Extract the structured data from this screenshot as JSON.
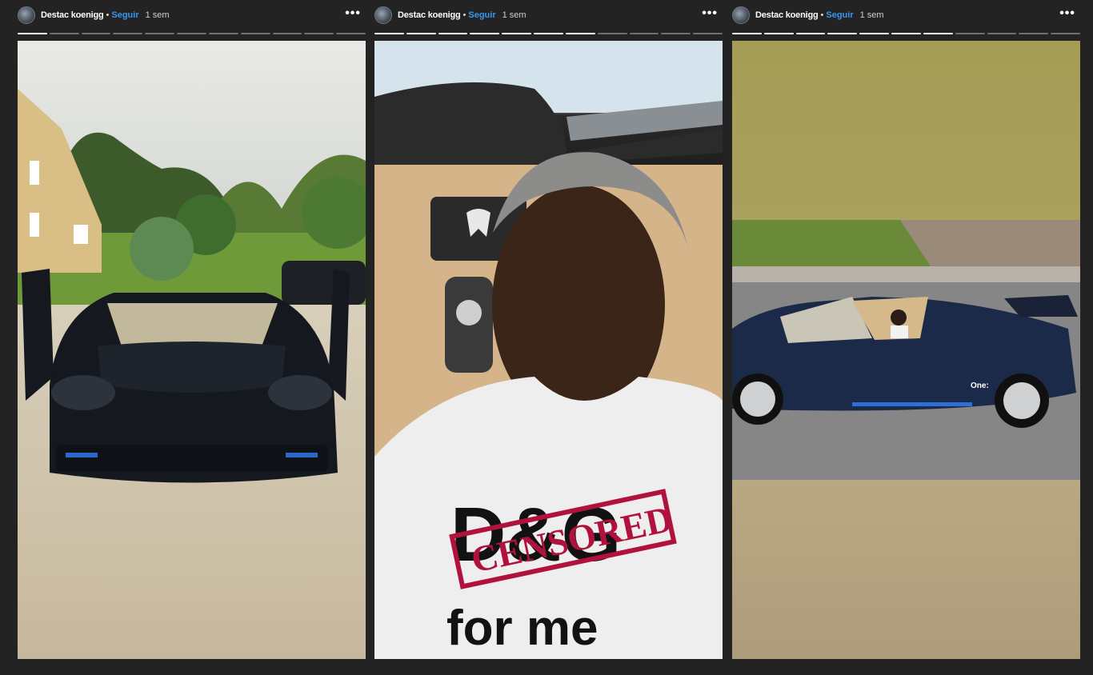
{
  "stories": [
    {
      "username": "Destac koenigg",
      "separator": "•",
      "follow_label": "Seguir",
      "time": "1 sem",
      "more_icon": "more-icon",
      "progress": {
        "segments": 11,
        "current_segment": 1
      }
    },
    {
      "username": "Destac koenigg",
      "separator": "•",
      "follow_label": "Seguir",
      "time": "1 sem",
      "more_icon": "more-icon",
      "progress": {
        "segments": 11,
        "current_segment": 7
      }
    },
    {
      "username": "Destac koenigg",
      "separator": "•",
      "follow_label": "Seguir",
      "time": "1 sem",
      "more_icon": "more-icon",
      "progress": {
        "segments": 11,
        "current_segment": 7
      }
    }
  ],
  "media_text": {
    "shirt_brand": "D&G",
    "shirt_line": "for me",
    "stamp": "CENSORED",
    "car_badge": "One:"
  }
}
